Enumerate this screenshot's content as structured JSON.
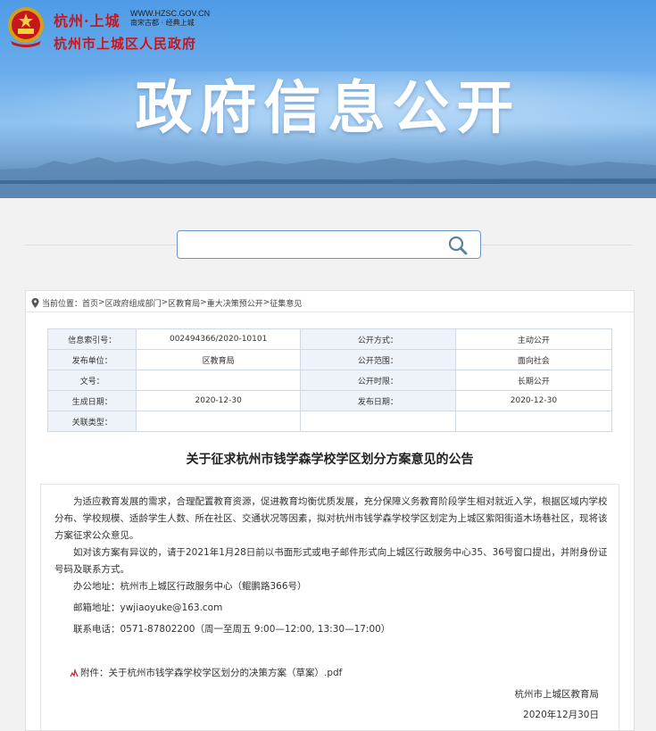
{
  "header": {
    "brand_line1": "杭州·上城",
    "url": "WWW.HZSC.GOV.CN",
    "slogan": "南宋古都 · 经典上城",
    "brand_line2": "杭州市上城区人民政府",
    "banner_title": "政府信息公开"
  },
  "search": {
    "placeholder": "",
    "value": ""
  },
  "breadcrumb": {
    "prefix": "当前位置：",
    "items": [
      "首页",
      "区政府组成部门",
      "区教育局",
      "重大决策预公开",
      "征集意见"
    ],
    "separator": " > "
  },
  "meta": {
    "rows": [
      [
        "信息索引号：",
        "002494366/2020-10101",
        "公开方式：",
        "主动公开"
      ],
      [
        "发布单位：",
        "区教育局",
        "公开范围：",
        "面向社会"
      ],
      [
        "文号：",
        "",
        "公开时限：",
        "长期公开"
      ],
      [
        "生成日期：",
        "2020-12-30",
        "发布日期：",
        "2020-12-30"
      ],
      [
        "关联类型：",
        "",
        "",
        ""
      ]
    ]
  },
  "document": {
    "title": "关于征求杭州市钱学森学校学区划分方案意见的公告",
    "para1": "为适应教育发展的需求，合理配置教育资源，促进教育均衡优质发展，充分保障义务教育阶段学生相对就近入学，根据区域内学校分布、学校规模、适龄学生人数、所在社区、交通状况等因素，拟对杭州市钱学森学校学区划定为上城区紫阳街道木场巷社区，现将该方案征求公众意见。",
    "para2": "如对该方案有异议的，请于2021年1月28日前以书面形式或电子邮件形式向上城区行政服务中心35、36号窗口提出，并附身份证号码及联系方式。",
    "address": "办公地址：杭州市上城区行政服务中心（鲲鹏路366号）",
    "email": "邮箱地址：ywjiaoyuke@163.com",
    "phone": "联系电话：0571-87802200（周一至周五 9:00—12:00, 13:30—17:00）",
    "attachment": "附件：关于杭州市钱学森学校学区划分的决策方案（草案）.pdf",
    "signer": "杭州市上城区教育局",
    "date": "2020年12月30日"
  },
  "colors": {
    "brand_red": "#c8161d",
    "banner_blue": "#4f9be6",
    "table_key_bg": "#eef3f9"
  }
}
